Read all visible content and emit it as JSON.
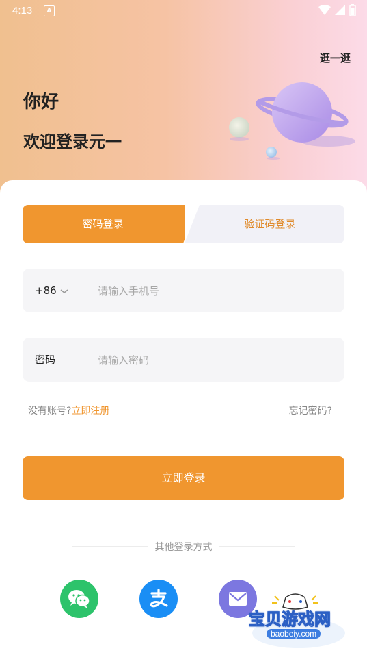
{
  "status_bar": {
    "time": "4:13",
    "notification_icon": "A",
    "icons": [
      "wifi-icon",
      "signal-icon",
      "battery-icon"
    ]
  },
  "header": {
    "browse_link": "逛一逛",
    "greeting": "你好",
    "welcome": "欢迎登录元一"
  },
  "tabs": [
    {
      "label": "密码登录",
      "active": true
    },
    {
      "label": "验证码登录",
      "active": false
    }
  ],
  "phone_field": {
    "country_code": "+86",
    "placeholder": "请输入手机号",
    "value": ""
  },
  "password_field": {
    "label": "密码",
    "placeholder": "请输入密码",
    "value": ""
  },
  "links": {
    "no_account": "没有账号?",
    "register": "立即注册",
    "forgot": "忘记密码?"
  },
  "login_button": "立即登录",
  "other_login": {
    "title": "其他登录方式",
    "methods": [
      "wechat-icon",
      "alipay-icon",
      "mail-icon"
    ]
  },
  "watermark": {
    "text": "宝贝游戏网",
    "url": "baobeiy.com"
  },
  "colors": {
    "accent": "#f0962f",
    "wechat": "#2dc36b",
    "alipay": "#1a8ef5",
    "mail": "#7c77e0"
  }
}
